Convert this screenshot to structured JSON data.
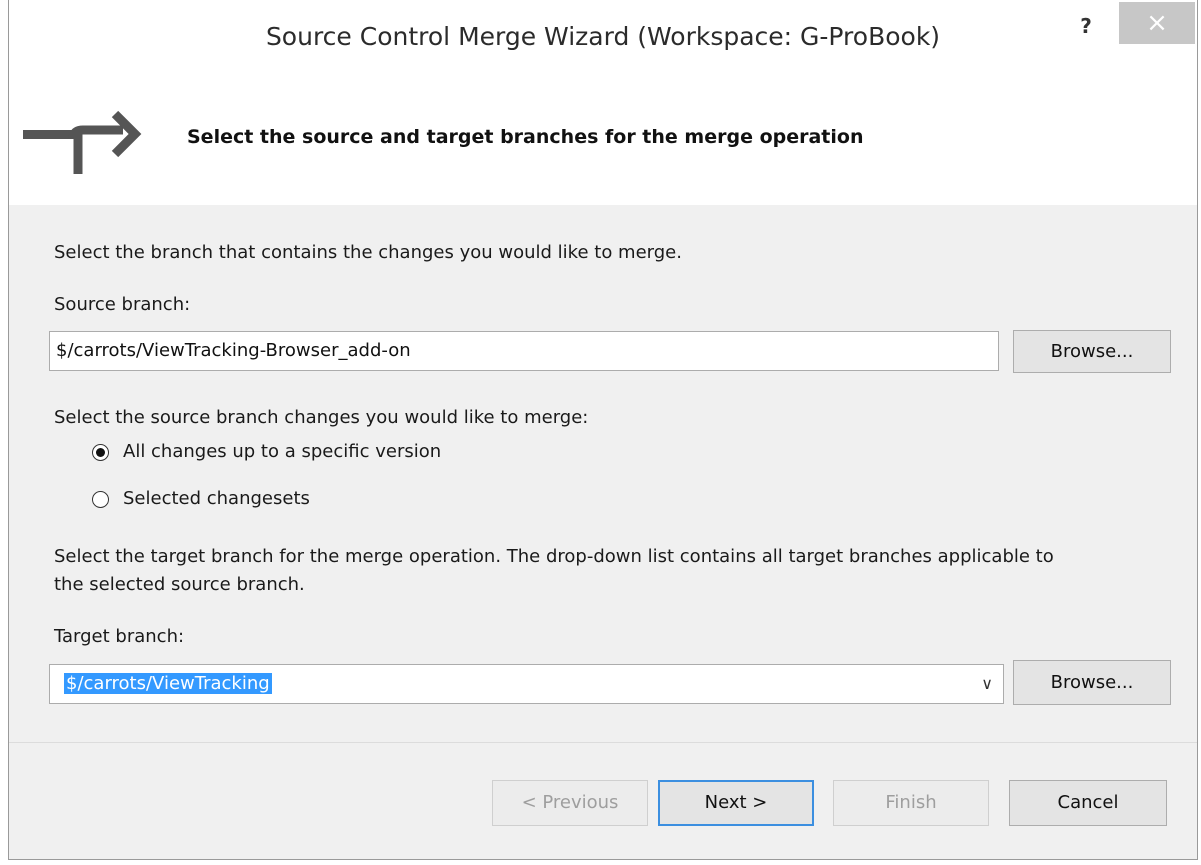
{
  "window": {
    "title": "Source Control Merge Wizard (Workspace: G-ProBook)",
    "help_label": "?",
    "close_label": "×"
  },
  "header": {
    "icon": "merge-arrow-icon",
    "text": "Select the source and target branches for the merge operation"
  },
  "source": {
    "instruction": "Select the branch that contains the changes you would like to merge.",
    "label": "Source branch:",
    "value": "$/carrots/ViewTracking-Browser_add-on",
    "browse_label": "Browse..."
  },
  "changes": {
    "instruction": "Select the source branch changes you would like to merge:",
    "options": [
      {
        "label": "All changes up to a specific version",
        "selected": true
      },
      {
        "label": "Selected changesets",
        "selected": false
      }
    ]
  },
  "target": {
    "instruction_line1": "Select the target branch for the merge operation.  The drop-down list contains all target branches applicable to",
    "instruction_line2": "the selected source branch.",
    "label": "Target branch:",
    "value": "$/carrots/ViewTracking",
    "dropdown_icon": "chevron-down-icon",
    "browse_label": "Browse..."
  },
  "footer": {
    "previous_label": "< Previous",
    "next_label": "Next >",
    "finish_label": "Finish",
    "cancel_label": "Cancel"
  },
  "colors": {
    "selection": "#3399ff",
    "default_button_border": "#3c8fe0",
    "close_button": "#c7c7c7"
  }
}
